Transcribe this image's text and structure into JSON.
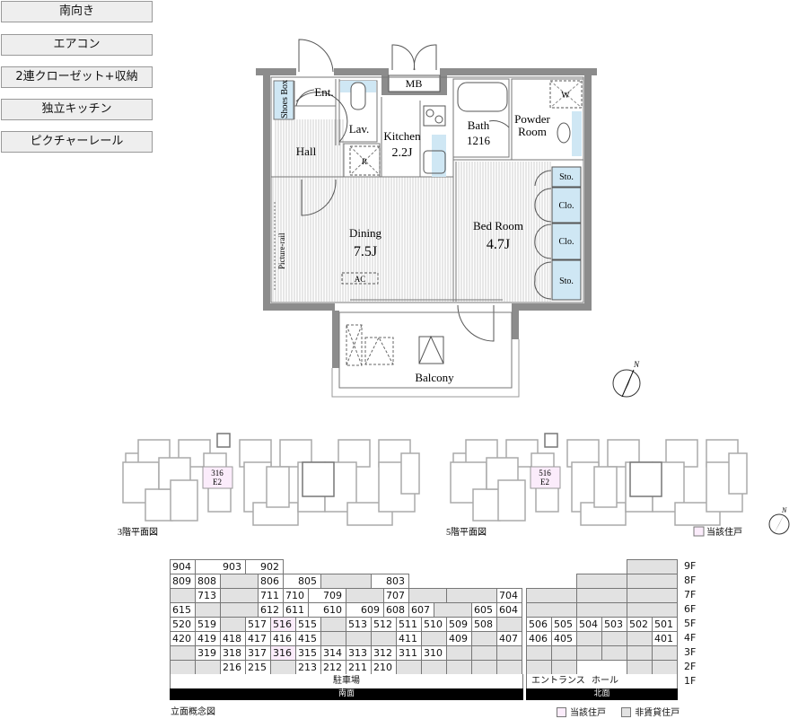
{
  "features": [
    "南向き",
    "エアコン",
    "2連クローゼット+収納",
    "独立キッチン",
    "ピクチャーレール"
  ],
  "floorplan": {
    "rooms": {
      "shoes_box": "Shoes Box",
      "ent": "Ent.",
      "lav": "Lav.",
      "hall": "Hall",
      "kitchen": "Kitchen",
      "kitchen_size": "2.2J",
      "mb": "MB",
      "bath": "Bath",
      "bath_size": "1216",
      "powder_room_1": "Powder",
      "powder_room_2": "Room",
      "w": "W",
      "r": "R",
      "dining": "Dining",
      "dining_size": "7.5J",
      "ac": "AC",
      "picture_rail": "Picture-rail",
      "bed_room": "Bed Room",
      "bed_room_size": "4.7J",
      "sto_top": "Sto.",
      "clo_1": "Clo.",
      "clo_2": "Clo.",
      "sto_bottom": "Sto.",
      "balcony": "Balcony"
    },
    "compass": "N",
    "colors": {
      "wall": "#8c8c8c",
      "water": "#cfe7f4"
    }
  },
  "key_plans": [
    {
      "title": "3階平面図",
      "unit": "316",
      "type": "E2"
    },
    {
      "title": "5階平面図",
      "unit": "516",
      "type": "E2"
    }
  ],
  "key_legend": "当該住戸",
  "compass_small": "N",
  "elevation": {
    "title": "立面概念図",
    "highlighted": [
      "516",
      "316"
    ],
    "south": {
      "rows": [
        [
          "904",
          "903",
          "902"
        ],
        [
          "809",
          "808",
          null,
          "806",
          "805",
          null,
          "803"
        ],
        [
          null,
          "713",
          null,
          "711",
          "710",
          "709",
          null,
          "707",
          null,
          null,
          "704"
        ],
        [
          "615",
          null,
          null,
          "612",
          "611",
          "610",
          "609",
          "608",
          "607",
          null,
          "605",
          "604"
        ],
        [
          "520",
          "519",
          null,
          "517",
          "516",
          "515",
          null,
          "513",
          "512",
          "511",
          "510",
          "509",
          "508",
          null
        ],
        [
          "420",
          "419",
          "418",
          "417",
          "416",
          "415",
          null,
          null,
          null,
          "411",
          null,
          "409",
          null,
          "407"
        ],
        [
          null,
          "319",
          "318",
          "317",
          "316",
          "315",
          "314",
          "313",
          "312",
          "311",
          "310",
          null,
          null,
          null
        ],
        [
          null,
          null,
          "216",
          "215",
          null,
          "213",
          "212",
          "211",
          "210",
          null,
          null,
          null,
          null,
          null
        ]
      ],
      "ground": "駐車場",
      "face": "南面"
    },
    "north": {
      "rows": [
        [
          null
        ],
        [
          null,
          null
        ],
        [
          null,
          null,
          null
        ],
        [
          null,
          null,
          null
        ],
        [
          "506",
          "505",
          "504",
          "503",
          "502",
          "501"
        ],
        [
          "406",
          "405",
          null,
          null,
          null,
          "401"
        ],
        [
          null,
          null,
          null,
          null,
          null,
          null
        ],
        [
          null,
          null,
          null,
          null
        ]
      ],
      "ground_1": "エントランス",
      "ground_2": "ホール",
      "face": "北面"
    },
    "floors": [
      "9F",
      "8F",
      "7F",
      "6F",
      "5F",
      "4F",
      "3F",
      "2F",
      "1F"
    ],
    "legend": [
      {
        "label": "当該住戸",
        "color": "#fbecfb"
      },
      {
        "label": "非賃貸住戸",
        "color": "#e2e2e2"
      }
    ]
  }
}
